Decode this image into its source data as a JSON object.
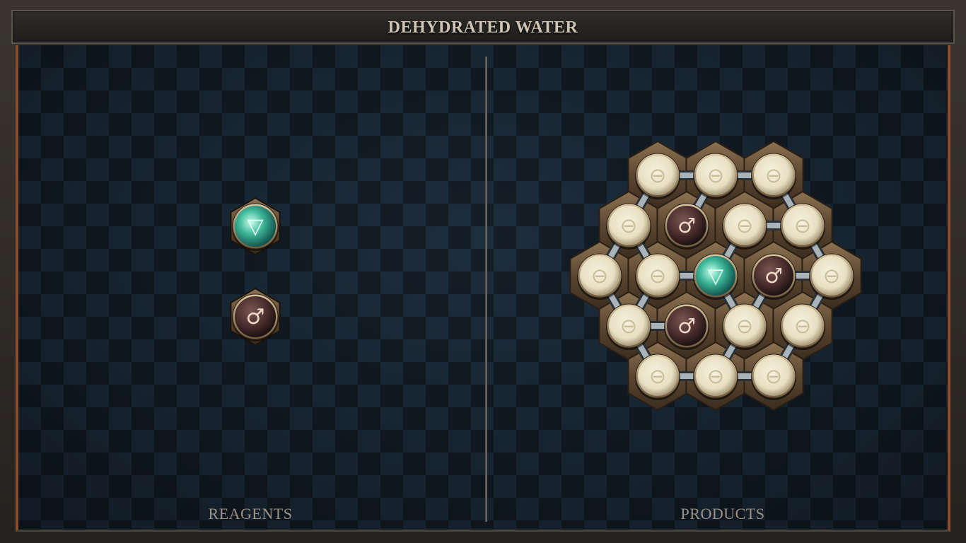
{
  "title": "DEHYDRATED WATER",
  "panels": {
    "reagents_label": "REAGENTS",
    "products_label": "PRODUCTS"
  },
  "symbols": {
    "salt": "⊖",
    "iron": "♂",
    "water": "▽"
  },
  "colors": {
    "salt_fill": "#e8dfc3",
    "iron_fill": "#4a2e2c",
    "water_fill": "#3fb89a",
    "frame_accent": "#8a4f2a",
    "label_text": "#9c9286",
    "title_text": "#cfc4b4"
  },
  "reagents": [
    {
      "element": "water",
      "col": 0,
      "row": 0
    },
    {
      "element": "iron",
      "col": 0,
      "row": 1
    }
  ],
  "product_molecule": {
    "atoms": [
      {
        "element": "salt",
        "q": 0,
        "r": -2
      },
      {
        "element": "salt",
        "q": 1,
        "r": -2
      },
      {
        "element": "salt",
        "q": 2,
        "r": -2
      },
      {
        "element": "salt",
        "q": -1,
        "r": -1
      },
      {
        "element": "iron",
        "q": 0,
        "r": -1
      },
      {
        "element": "salt",
        "q": 1,
        "r": -1
      },
      {
        "element": "salt",
        "q": 2,
        "r": -1
      },
      {
        "element": "salt",
        "q": -2,
        "r": 0
      },
      {
        "element": "salt",
        "q": -1,
        "r": 0
      },
      {
        "element": "water",
        "q": 0,
        "r": 0
      },
      {
        "element": "iron",
        "q": 1,
        "r": 0
      },
      {
        "element": "salt",
        "q": 2,
        "r": 0
      },
      {
        "element": "salt",
        "q": -2,
        "r": 1
      },
      {
        "element": "iron",
        "q": -1,
        "r": 1
      },
      {
        "element": "salt",
        "q": 0,
        "r": 1
      },
      {
        "element": "salt",
        "q": 1,
        "r": 1
      },
      {
        "element": "salt",
        "q": -2,
        "r": 2
      },
      {
        "element": "salt",
        "q": -1,
        "r": 2
      },
      {
        "element": "salt",
        "q": 0,
        "r": 2
      }
    ],
    "bonds": [
      [
        0,
        1
      ],
      [
        1,
        2
      ],
      [
        0,
        3
      ],
      [
        1,
        4
      ],
      [
        2,
        6
      ],
      [
        3,
        8
      ],
      [
        3,
        7
      ],
      [
        5,
        6
      ],
      [
        5,
        9
      ],
      [
        6,
        11
      ],
      [
        7,
        12
      ],
      [
        8,
        9
      ],
      [
        8,
        12
      ],
      [
        10,
        11
      ],
      [
        10,
        14
      ],
      [
        11,
        15
      ],
      [
        12,
        13
      ],
      [
        12,
        16
      ],
      [
        14,
        9
      ],
      [
        14,
        17
      ],
      [
        15,
        18
      ],
      [
        16,
        17
      ],
      [
        17,
        18
      ]
    ]
  }
}
